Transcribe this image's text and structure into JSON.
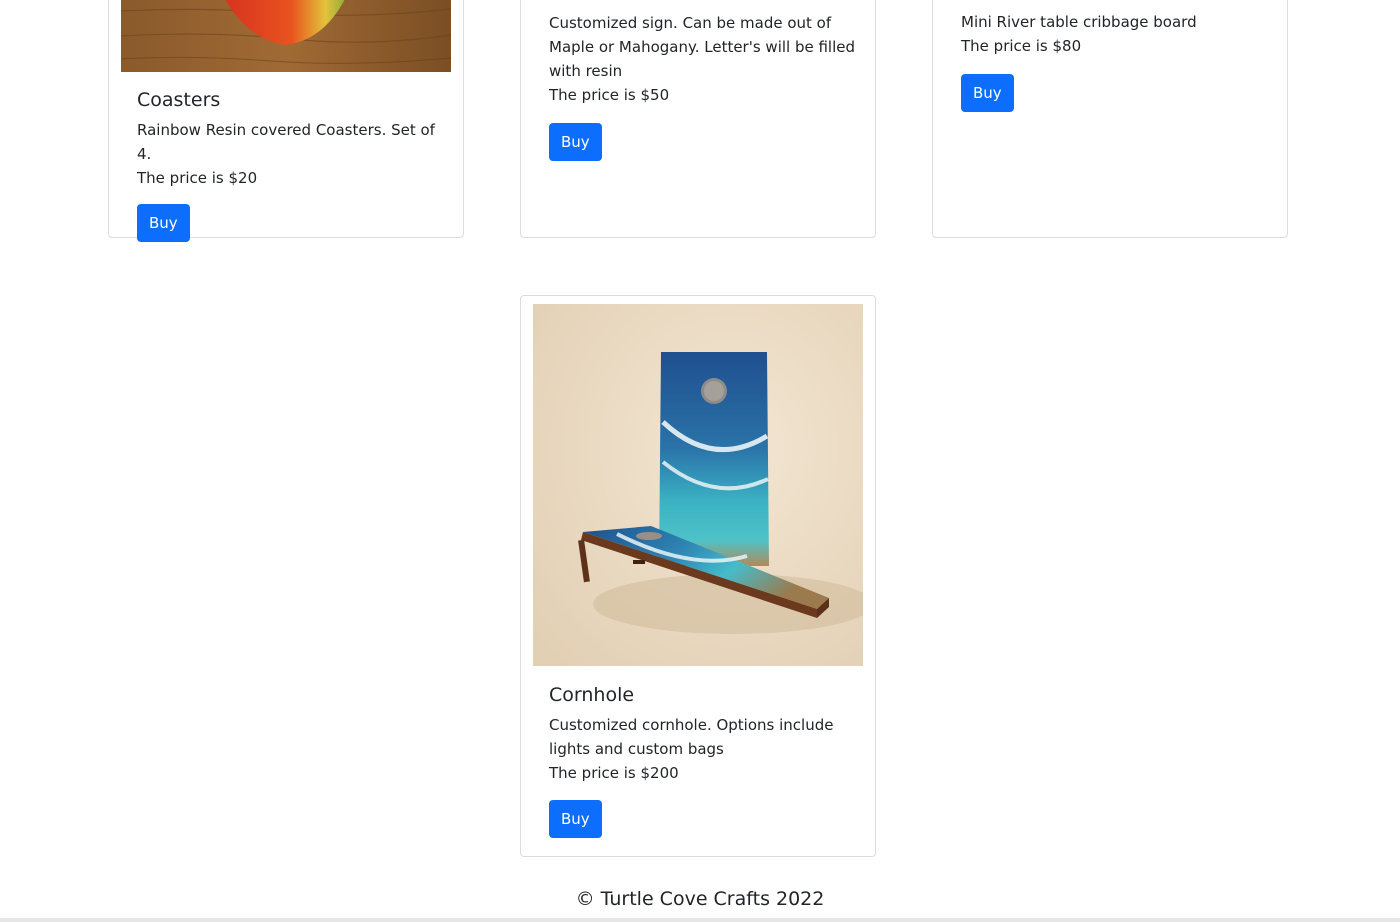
{
  "products": [
    {
      "title": "Coasters",
      "description": "Rainbow Resin covered Coasters. Set of 4.",
      "price": "The price is $20",
      "button_label": "Buy"
    },
    {
      "title": "",
      "description": "Customized sign. Can be made out of Maple or Mahogany. Letter's will be filled with resin",
      "price": "The price is $50",
      "button_label": "Buy"
    },
    {
      "title": "",
      "description": "Mini River table cribbage board",
      "price": "The price is $80",
      "button_label": "Buy"
    },
    {
      "title": "Cornhole",
      "description": "Customized cornhole. Options include lights and custom bags",
      "price": "The price is $200",
      "button_label": "Buy"
    }
  ],
  "footer": {
    "text": "© Turtle Cove Crafts 2022"
  },
  "colors": {
    "primary_button": "#0d6efd",
    "card_border": "#dcdcdc",
    "text": "#212529"
  }
}
